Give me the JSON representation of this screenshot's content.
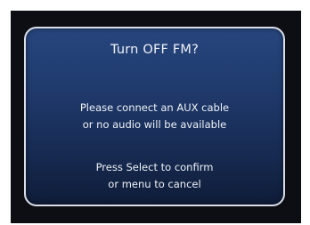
{
  "dialog": {
    "title": "Turn OFF FM?",
    "message_line1": "Please connect an AUX cable",
    "message_line2": "or no audio will be available",
    "instruction_line1": "Press Select to confirm",
    "instruction_line2": "or menu to cancel"
  },
  "colors": {
    "screen_background": "#0c0e14",
    "dialog_top": "#27467e",
    "dialog_bottom": "#0f1c38",
    "border": "#d9dee8",
    "text": "#eef2f8"
  }
}
